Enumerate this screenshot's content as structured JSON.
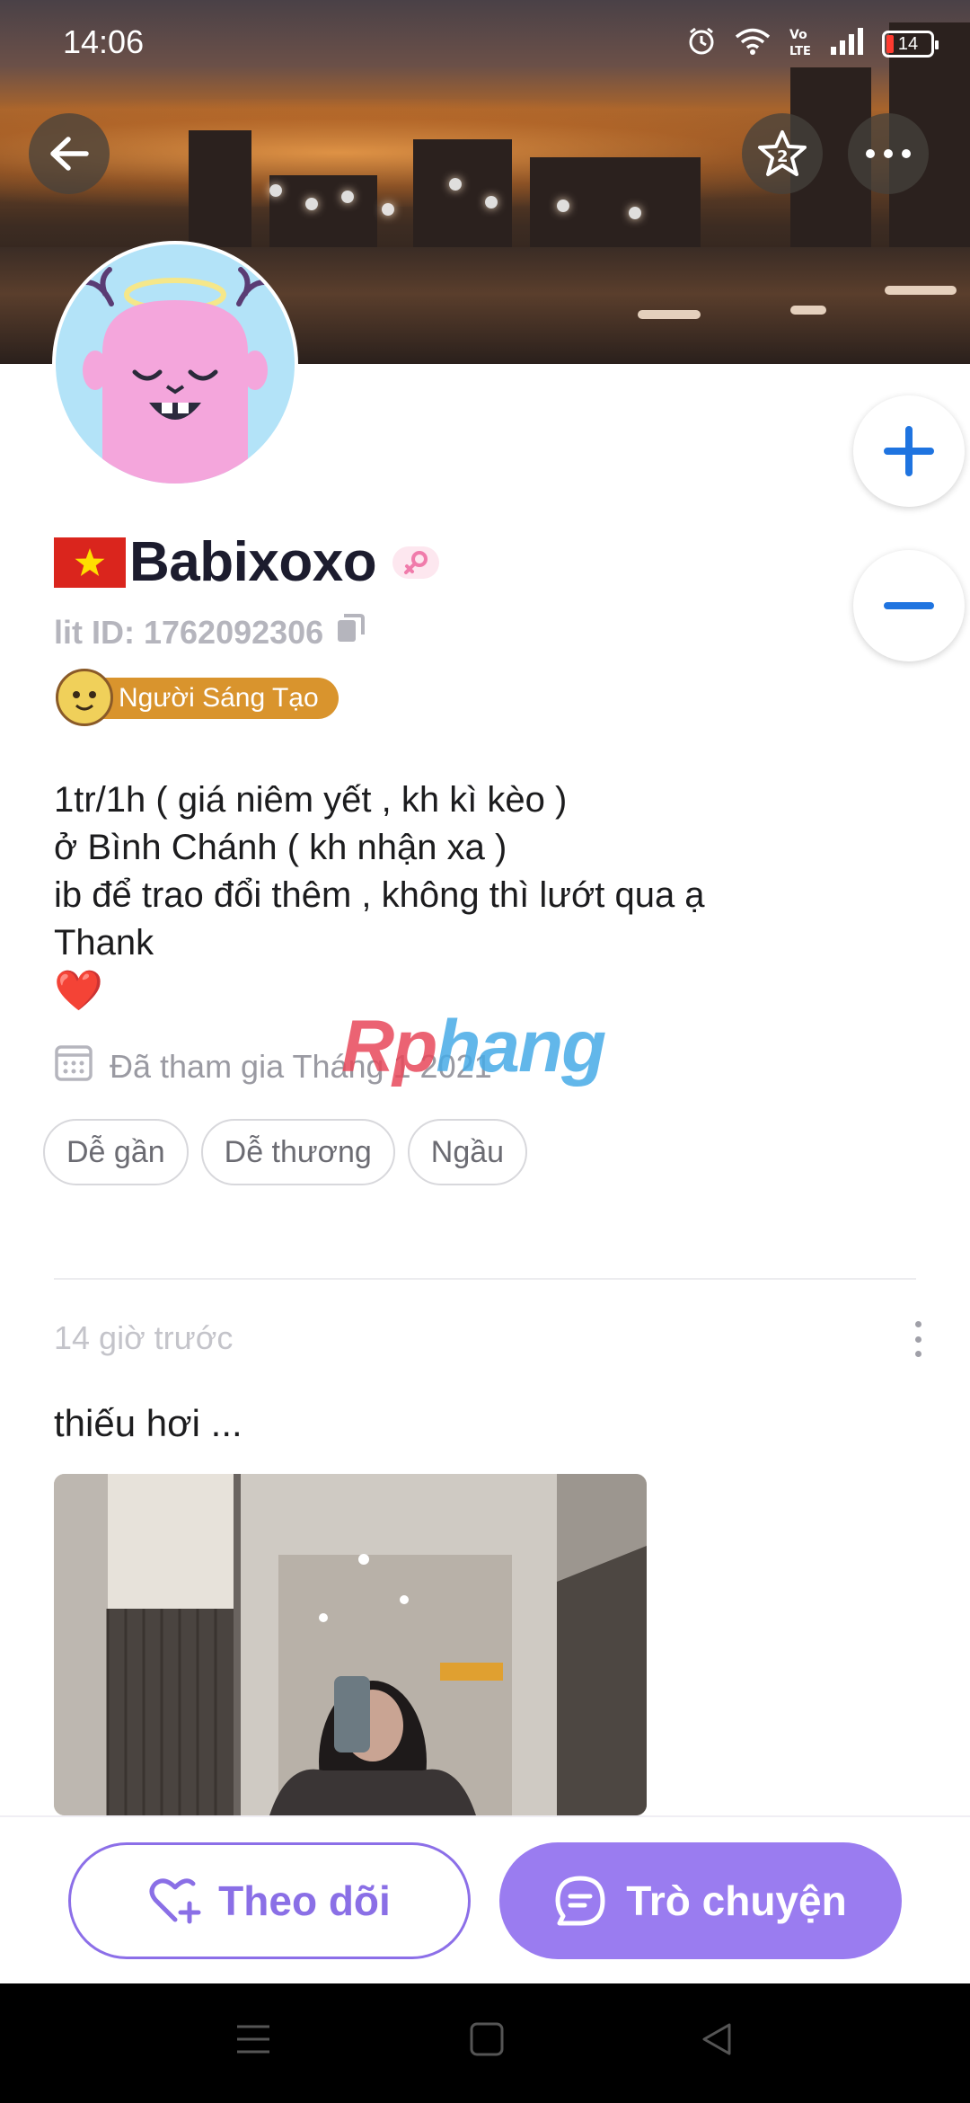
{
  "status_bar": {
    "time": "14:06",
    "battery": "14",
    "icons": [
      "alarm-icon",
      "wifi-icon",
      "volte-icon",
      "signal-icon",
      "battery-icon"
    ]
  },
  "header": {
    "back_icon": "arrow-left-icon",
    "star_icon": "star-icon",
    "star_count": "2",
    "more_icon": "more-horizontal-icon"
  },
  "profile": {
    "flag": "vietnam-flag",
    "username": "Babixoxo",
    "gender_icon": "female-icon",
    "lit_id": "lit ID: 1762092306",
    "copy_icon": "copy-icon",
    "badge": "Người Sáng Tạo",
    "bio": [
      "1tr/1h ( giá niêm yết , kh kì kèo )",
      "ở Bình Chánh ( kh nhận xa )",
      "ib để trao đổi thêm , không thì lướt qua ạ",
      "Thank",
      "❤️"
    ],
    "joined": "Đã tham gia Tháng 1 2021",
    "tags": [
      "Dễ gần",
      "Dễ thương",
      "Ngầu"
    ]
  },
  "zoom": {
    "plus": "+",
    "minus": "−"
  },
  "watermark": {
    "part1": "Rp",
    "part2": "hang"
  },
  "post": {
    "time": "14 giờ trước",
    "text": "thiếu hơi ..."
  },
  "actions": {
    "follow_label": "Theo dõi",
    "chat_label": "Trò chuyện"
  },
  "colors": {
    "accent_purple": "#9a7cf0",
    "badge_orange": "#d9942d",
    "plus_blue": "#1f74e0"
  }
}
